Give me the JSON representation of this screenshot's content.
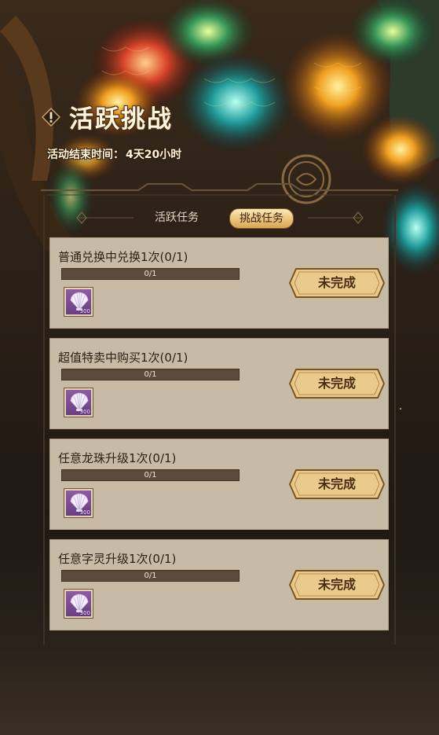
{
  "header": {
    "title": "活跃挑战",
    "end_time_label": "活动结束时间：",
    "end_time_value": "4天20小时"
  },
  "tabs": [
    {
      "label": "活跃任务",
      "active": false
    },
    {
      "label": "挑战任务",
      "active": true
    }
  ],
  "tasks": [
    {
      "title": "普通兑换中兑换1次(0/1)",
      "progress_text": "0/1",
      "progress": 0,
      "reward_count": "300",
      "reward_icon": "shell-icon",
      "status": "未完成"
    },
    {
      "title": "超值特卖中购买1次(0/1)",
      "progress_text": "0/1",
      "progress": 0,
      "reward_count": "300",
      "reward_icon": "shell-icon",
      "status": "未完成"
    },
    {
      "title": "任意龙珠升级1次(0/1)",
      "progress_text": "0/1",
      "progress": 0,
      "reward_count": "300",
      "reward_icon": "shell-icon",
      "status": "未完成"
    },
    {
      "title": "任意字灵升级1次(0/1)",
      "progress_text": "0/1",
      "progress": 0,
      "reward_count": "300",
      "reward_icon": "shell-icon",
      "status": "未完成"
    }
  ],
  "colors": {
    "card_bg": "#c8bba5",
    "progress_track": "#5b4b3d",
    "button_gold": "#e9c98c",
    "active_tab": "#e9c47c",
    "reward_purple": "#7b4a94"
  }
}
